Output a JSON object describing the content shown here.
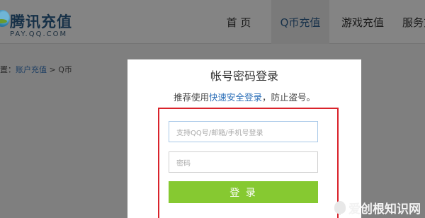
{
  "header": {
    "logo_name": "腾讯充值",
    "logo_url": "PAY.QQ.COM",
    "nav": [
      {
        "label": "首 页"
      },
      {
        "label": "Q币充值",
        "active": true
      },
      {
        "label": "游戏充值"
      },
      {
        "label": "服务充"
      }
    ]
  },
  "breadcrumb": {
    "prefix": "置：",
    "link": "账户充值",
    "separator": " > ",
    "current": "Q币"
  },
  "login": {
    "title": "帐号密码登录",
    "tip_before": "推荐使用",
    "tip_link": "快速安全登录",
    "tip_after": "，防止盗号。",
    "account_placeholder": "支持QQ号/邮箱/手机号登录",
    "password_placeholder": "密码",
    "submit_label": "登 录"
  },
  "watermark": "爱创根知识网",
  "colors": {
    "accent_green": "#86c931",
    "highlight_red": "#d9232b",
    "link_blue": "#2c6fb8"
  }
}
